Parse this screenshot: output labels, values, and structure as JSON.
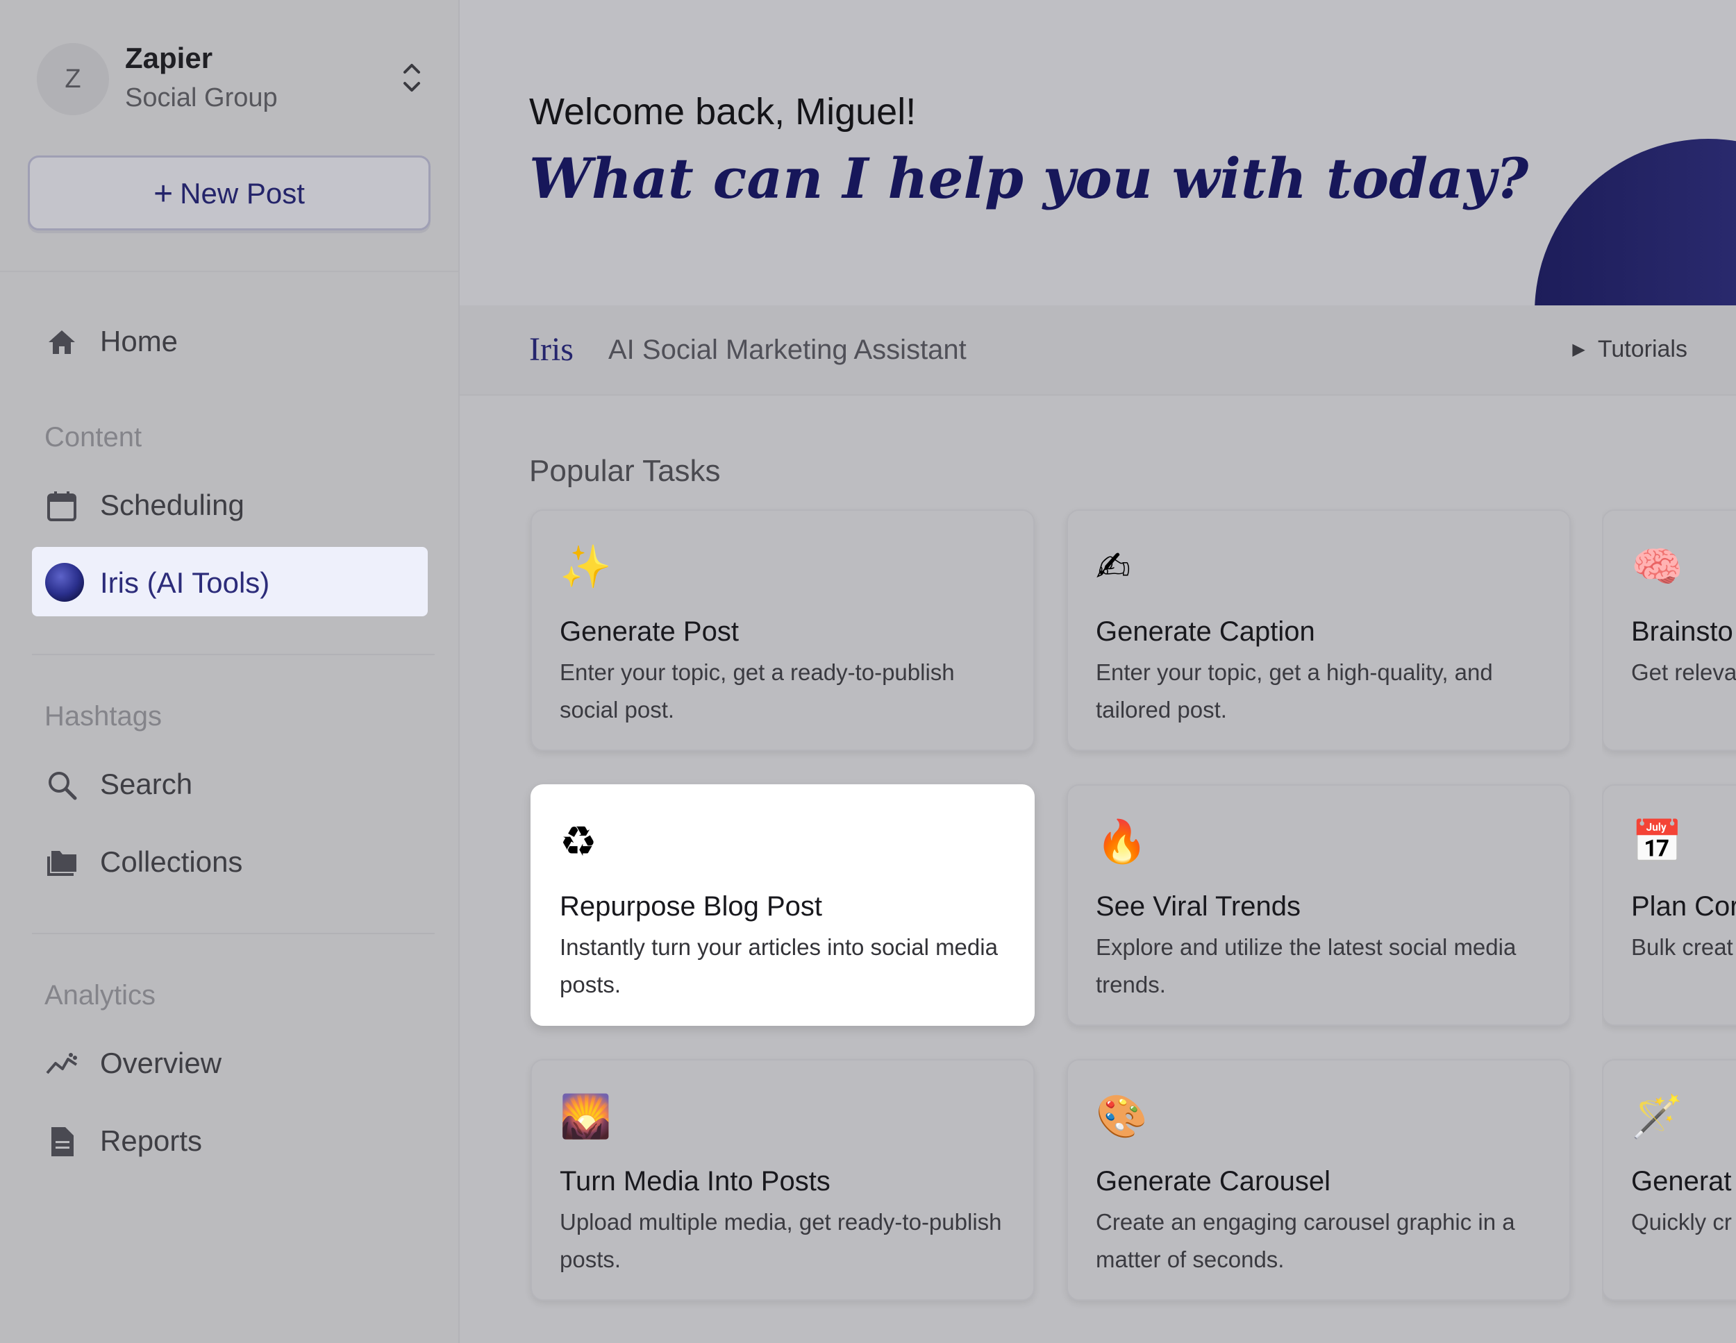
{
  "workspace": {
    "avatar_letter": "Z",
    "name": "Zapier",
    "subtitle": "Social Group"
  },
  "new_post": {
    "label": "New Post"
  },
  "nav": {
    "home": "Home",
    "content_label": "Content",
    "scheduling": "Scheduling",
    "iris": "Iris (AI Tools)",
    "hashtags_label": "Hashtags",
    "search": "Search",
    "collections": "Collections",
    "analytics_label": "Analytics",
    "overview": "Overview",
    "reports": "Reports"
  },
  "hero": {
    "welcome": "Welcome back, Miguel!",
    "headline": "What can I help you with today?"
  },
  "iris_bar": {
    "name": "Iris",
    "subtitle": "AI Social Marketing Assistant",
    "tutorials": "Tutorials"
  },
  "popular": {
    "title": "Popular Tasks",
    "cards": [
      {
        "icon": "sparkles-icon",
        "emoji": "✨",
        "title": "Generate Post",
        "desc": "Enter your topic, get a ready-to-publish social post."
      },
      {
        "icon": "writing-hand-icon",
        "emoji": "✍",
        "title": "Generate Caption",
        "desc": "Enter your topic, get a high-quality, and tailored post."
      },
      {
        "icon": "brain-icon",
        "emoji": "🧠",
        "title": "Brainsto",
        "desc": "Get releva your acco"
      },
      {
        "icon": "recycle-icon",
        "emoji": "♻",
        "title": "Repurpose Blog Post",
        "desc": "Instantly turn your articles into social media posts."
      },
      {
        "icon": "fire-icon",
        "emoji": "🔥",
        "title": "See Viral Trends",
        "desc": "Explore and utilize the latest social media trends."
      },
      {
        "icon": "calendar-icon",
        "emoji": "📅",
        "title": "Plan Cor",
        "desc": "Bulk creat strategy a"
      },
      {
        "icon": "sunset-image-icon",
        "emoji": "🌄",
        "title": "Turn Media Into Posts",
        "desc": "Upload multiple media, get ready-to-publish posts."
      },
      {
        "icon": "palette-icon",
        "emoji": "🎨",
        "title": "Generate Carousel",
        "desc": "Create an engaging carousel graphic in a matter of seconds."
      },
      {
        "icon": "magic-wand-icon",
        "emoji": "🪄",
        "title": "Generat",
        "desc": "Quickly cr social me"
      }
    ]
  },
  "colors": {
    "accent": "#24246a",
    "active_bg": "#eef0fb",
    "highlight_card": "#ffffff"
  }
}
